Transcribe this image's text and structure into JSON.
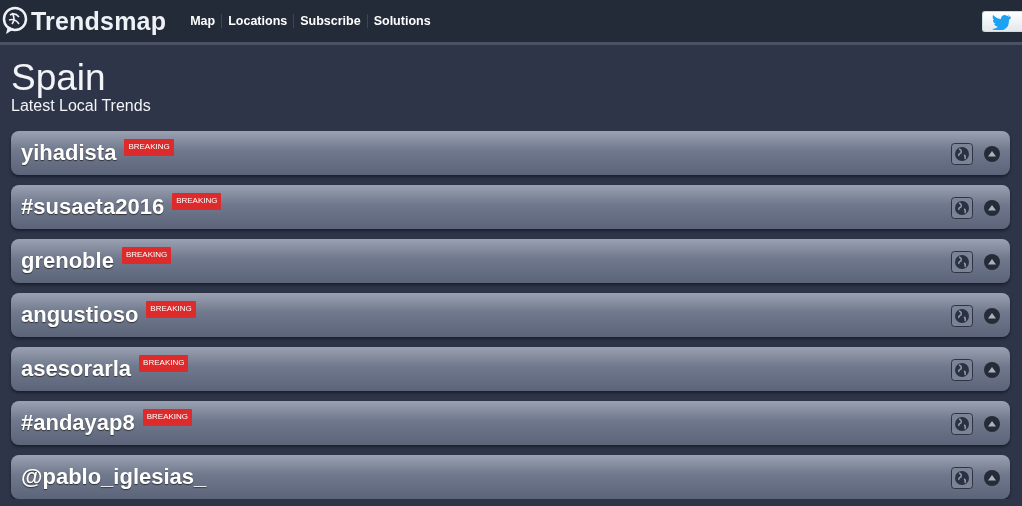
{
  "brand": "Trendsmap",
  "nav": [
    "Map",
    "Locations",
    "Subscribe",
    "Solutions"
  ],
  "title": "Spain",
  "subtitle": "Latest Local Trends",
  "trends": [
    {
      "label": "yihadista",
      "badge": "BREAKING"
    },
    {
      "label": "#susaeta2016",
      "badge": "BREAKING"
    },
    {
      "label": "grenoble",
      "badge": "BREAKING"
    },
    {
      "label": "angustioso",
      "badge": "BREAKING"
    },
    {
      "label": "asesorarla",
      "badge": "BREAKING"
    },
    {
      "label": "#andayap8",
      "badge": "BREAKING"
    },
    {
      "label": "@pablo_iglesias_"
    }
  ]
}
